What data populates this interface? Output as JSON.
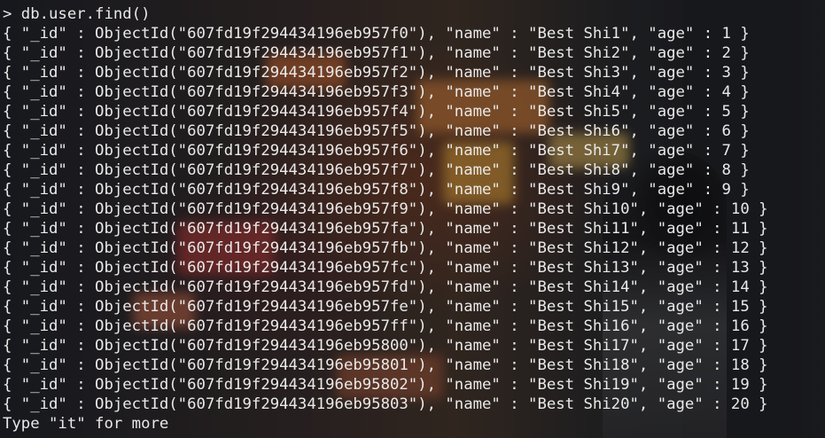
{
  "terminal": {
    "command_line": "> db.user.find()",
    "output_lines": [
      "{ \"_id\" : ObjectId(\"607fd19f294434196eb957f0\"), \"name\" : \"Best Shi1\", \"age\" : 1 }",
      "{ \"_id\" : ObjectId(\"607fd19f294434196eb957f1\"), \"name\" : \"Best Shi2\", \"age\" : 2 }",
      "{ \"_id\" : ObjectId(\"607fd19f294434196eb957f2\"), \"name\" : \"Best Shi3\", \"age\" : 3 }",
      "{ \"_id\" : ObjectId(\"607fd19f294434196eb957f3\"), \"name\" : \"Best Shi4\", \"age\" : 4 }",
      "{ \"_id\" : ObjectId(\"607fd19f294434196eb957f4\"), \"name\" : \"Best Shi5\", \"age\" : 5 }",
      "{ \"_id\" : ObjectId(\"607fd19f294434196eb957f5\"), \"name\" : \"Best Shi6\", \"age\" : 6 }",
      "{ \"_id\" : ObjectId(\"607fd19f294434196eb957f6\"), \"name\" : \"Best Shi7\", \"age\" : 7 }",
      "{ \"_id\" : ObjectId(\"607fd19f294434196eb957f7\"), \"name\" : \"Best Shi8\", \"age\" : 8 }",
      "{ \"_id\" : ObjectId(\"607fd19f294434196eb957f8\"), \"name\" : \"Best Shi9\", \"age\" : 9 }",
      "{ \"_id\" : ObjectId(\"607fd19f294434196eb957f9\"), \"name\" : \"Best Shi10\", \"age\" : 10 }",
      "{ \"_id\" : ObjectId(\"607fd19f294434196eb957fa\"), \"name\" : \"Best Shi11\", \"age\" : 11 }",
      "{ \"_id\" : ObjectId(\"607fd19f294434196eb957fb\"), \"name\" : \"Best Shi12\", \"age\" : 12 }",
      "{ \"_id\" : ObjectId(\"607fd19f294434196eb957fc\"), \"name\" : \"Best Shi13\", \"age\" : 13 }",
      "{ \"_id\" : ObjectId(\"607fd19f294434196eb957fd\"), \"name\" : \"Best Shi14\", \"age\" : 14 }",
      "{ \"_id\" : ObjectId(\"607fd19f294434196eb957fe\"), \"name\" : \"Best Shi15\", \"age\" : 15 }",
      "{ \"_id\" : ObjectId(\"607fd19f294434196eb957ff\"), \"name\" : \"Best Shi16\", \"age\" : 16 }",
      "{ \"_id\" : ObjectId(\"607fd19f294434196eb95800\"), \"name\" : \"Best Shi17\", \"age\" : 17 }",
      "{ \"_id\" : ObjectId(\"607fd19f294434196eb95801\"), \"name\" : \"Best Shi18\", \"age\" : 18 }",
      "{ \"_id\" : ObjectId(\"607fd19f294434196eb95802\"), \"name\" : \"Best Shi19\", \"age\" : 19 }",
      "{ \"_id\" : ObjectId(\"607fd19f294434196eb95803\"), \"name\" : \"Best Shi20\", \"age\" : 20 }"
    ],
    "footer_line": "Type \"it\" for more",
    "text_color": "#e9e9e9",
    "background_overlay": "#000000"
  }
}
